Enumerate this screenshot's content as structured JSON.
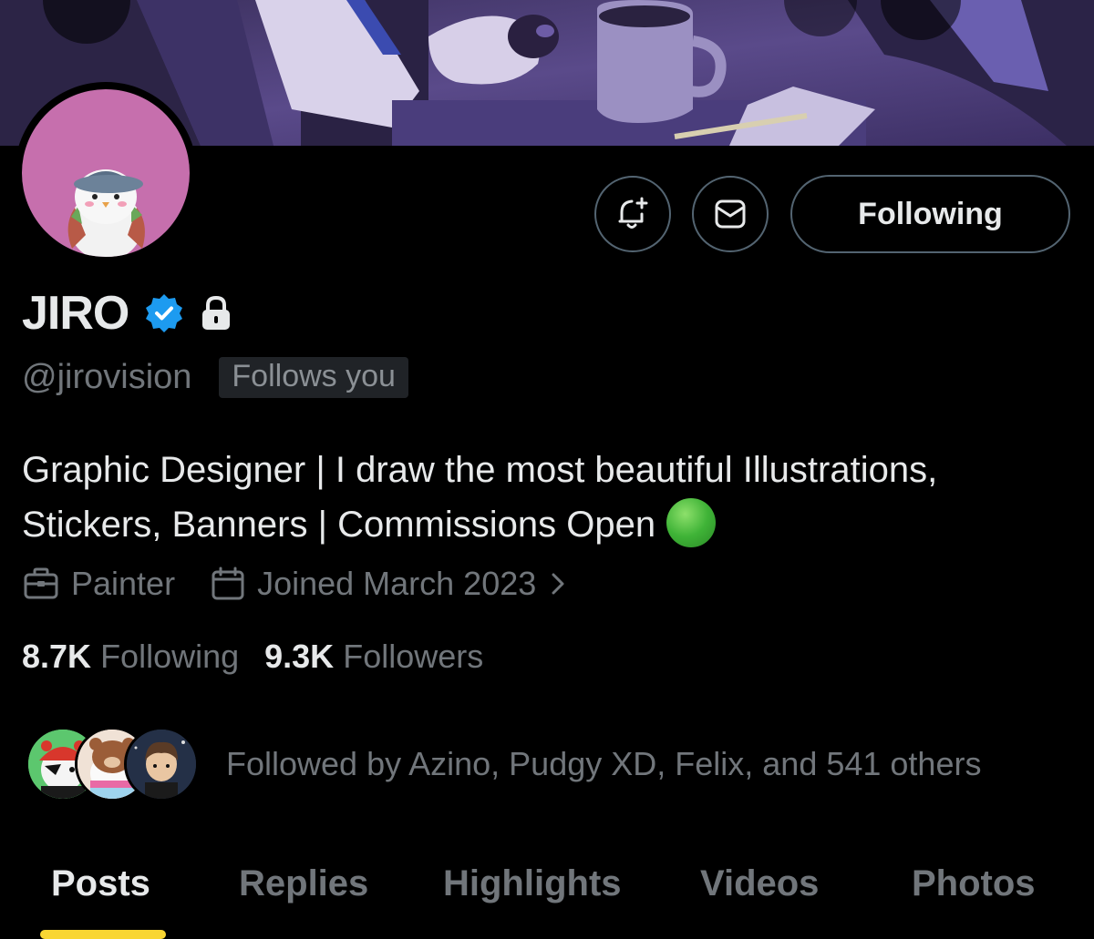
{
  "profile": {
    "name": "JIRO",
    "handle": "@jirovision",
    "follows_you": "Follows you",
    "bio_line1": "Graphic Designer | I draw the most beautiful Illustrations,",
    "bio_line2": "Stickers, Banners | Commissions Open",
    "category": "Painter",
    "joined": "Joined March 2023",
    "following_count": "8.7K",
    "following_label": "Following",
    "followers_count": "9.3K",
    "followers_label": "Followers",
    "followed_by": "Followed by Azino, Pudgy XD, Felix, and 541 others"
  },
  "actions": {
    "following_button": "Following"
  },
  "tabs": [
    {
      "label": "Posts",
      "active": true
    },
    {
      "label": "Replies",
      "active": false
    },
    {
      "label": "Highlights",
      "active": false
    },
    {
      "label": "Videos",
      "active": false
    },
    {
      "label": "Photos",
      "active": false
    }
  ],
  "colors": {
    "background": "#000000",
    "text_primary": "#e7e9ea",
    "text_secondary": "#71767b",
    "border": "#536471",
    "verified_blue": "#1d9bf0",
    "tab_indicator": "#f9d633",
    "avatar_bg": "#c66fad"
  },
  "icons": {
    "verified": "verified-badge-icon",
    "lock": "lock-icon",
    "bell": "bell-plus-icon",
    "message": "envelope-icon",
    "category": "briefcase-icon",
    "joined": "calendar-icon",
    "chevron": "chevron-right-icon"
  }
}
